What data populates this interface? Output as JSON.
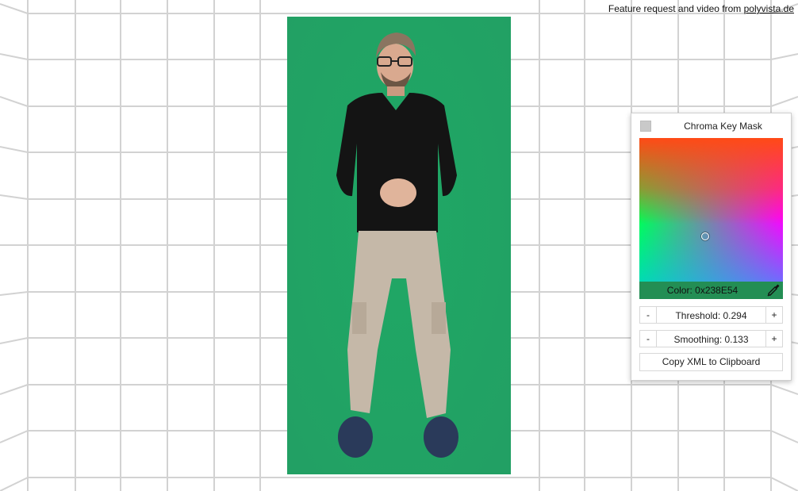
{
  "credit": {
    "text": "Feature request and video from ",
    "link": "polyvista.de"
  },
  "video": {
    "subject_description": "Person standing in front of green screen",
    "background_color": "#23a366"
  },
  "panel": {
    "title": "Chroma Key Mask",
    "enabled": false,
    "color_label": "Color: 0x238E54",
    "color_value": "#238e54",
    "threshold_label": "Threshold: 0.294",
    "threshold_value": 0.294,
    "smoothing_label": "Smoothing: 0.133",
    "smoothing_value": 0.133,
    "minus_label": "-",
    "plus_label": "+",
    "copy_label": "Copy XML to Clipboard"
  }
}
